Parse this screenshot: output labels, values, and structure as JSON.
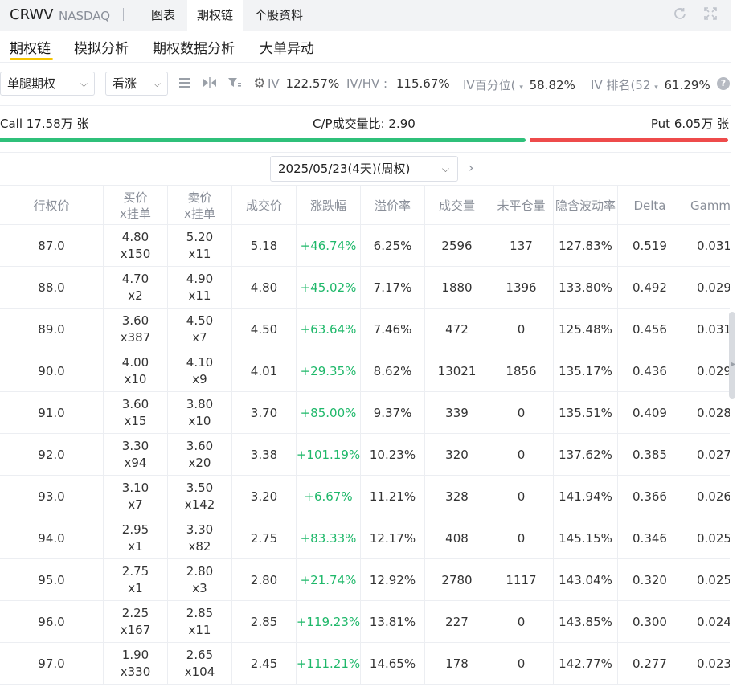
{
  "header": {
    "ticker": "CRWV",
    "exchange": "NASDAQ",
    "tabs": [
      "图表",
      "期权链",
      "个股资料"
    ],
    "active_tab": "期权链"
  },
  "subtabs": {
    "items": [
      "期权链",
      "模拟分析",
      "期权数据分析",
      "大单异动"
    ],
    "active": "期权链"
  },
  "toolbar": {
    "strategy_select": "单腿期权",
    "direction_select": "看涨",
    "iv_label": "IV",
    "iv_value": "122.57%",
    "ivhv_label": "IV/HV :",
    "ivhv_value": "115.67%",
    "ivpct_label": "IV百分位(",
    "ivpct_value": "58.82%",
    "ivrank_label": "IV 排名(52",
    "ivrank_value": "61.29%"
  },
  "ratio": {
    "call": "Call 17.58万 张",
    "cp": "C/P成交量比: 2.90",
    "put": "Put 6.05万 张",
    "call_fraction": 0.744
  },
  "expiry": {
    "selected": "2025/05/23(4天)(周权)"
  },
  "table": {
    "headers": [
      {
        "l1": "行权价",
        "l2": ""
      },
      {
        "l1": "买价",
        "l2": "x挂单"
      },
      {
        "l1": "卖价",
        "l2": "x挂单"
      },
      {
        "l1": "成交价",
        "l2": ""
      },
      {
        "l1": "涨跌幅",
        "l2": ""
      },
      {
        "l1": "溢价率",
        "l2": ""
      },
      {
        "l1": "成交量",
        "l2": ""
      },
      {
        "l1": "未平仓量",
        "l2": ""
      },
      {
        "l1": "隐含波动率",
        "l2": ""
      },
      {
        "l1": "Delta",
        "l2": ""
      },
      {
        "l1": "Gamm",
        "l2": ""
      }
    ],
    "rows": [
      {
        "strike": "87.0",
        "bid": "4.80",
        "bid_size": "x150",
        "ask": "5.20",
        "ask_size": "x11",
        "last": "5.18",
        "change": "+46.74%",
        "premium": "6.25%",
        "volume": "2596",
        "oi": "137",
        "iv": "127.83%",
        "delta": "0.519",
        "gamma": "0.031"
      },
      {
        "strike": "88.0",
        "bid": "4.70",
        "bid_size": "x2",
        "ask": "4.90",
        "ask_size": "x11",
        "last": "4.80",
        "change": "+45.02%",
        "premium": "7.17%",
        "volume": "1880",
        "oi": "1396",
        "iv": "133.80%",
        "delta": "0.492",
        "gamma": "0.029"
      },
      {
        "strike": "89.0",
        "bid": "3.60",
        "bid_size": "x387",
        "ask": "4.50",
        "ask_size": "x7",
        "last": "4.50",
        "change": "+63.64%",
        "premium": "7.46%",
        "volume": "472",
        "oi": "0",
        "iv": "125.48%",
        "delta": "0.456",
        "gamma": "0.031"
      },
      {
        "strike": "90.0",
        "bid": "4.00",
        "bid_size": "x10",
        "ask": "4.10",
        "ask_size": "x9",
        "last": "4.01",
        "change": "+29.35%",
        "premium": "8.62%",
        "volume": "13021",
        "oi": "1856",
        "iv": "135.17%",
        "delta": "0.436",
        "gamma": "0.029"
      },
      {
        "strike": "91.0",
        "bid": "3.60",
        "bid_size": "x15",
        "ask": "3.80",
        "ask_size": "x10",
        "last": "3.70",
        "change": "+85.00%",
        "premium": "9.37%",
        "volume": "339",
        "oi": "0",
        "iv": "135.51%",
        "delta": "0.409",
        "gamma": "0.028"
      },
      {
        "strike": "92.0",
        "bid": "3.30",
        "bid_size": "x94",
        "ask": "3.60",
        "ask_size": "x20",
        "last": "3.38",
        "change": "+101.19%",
        "premium": "10.23%",
        "volume": "320",
        "oi": "0",
        "iv": "137.62%",
        "delta": "0.385",
        "gamma": "0.027"
      },
      {
        "strike": "93.0",
        "bid": "3.10",
        "bid_size": "x7",
        "ask": "3.50",
        "ask_size": "x142",
        "last": "3.20",
        "change": "+6.67%",
        "premium": "11.21%",
        "volume": "328",
        "oi": "0",
        "iv": "141.94%",
        "delta": "0.366",
        "gamma": "0.026"
      },
      {
        "strike": "94.0",
        "bid": "2.95",
        "bid_size": "x1",
        "ask": "3.30",
        "ask_size": "x82",
        "last": "2.75",
        "change": "+83.33%",
        "premium": "12.17%",
        "volume": "408",
        "oi": "0",
        "iv": "145.15%",
        "delta": "0.346",
        "gamma": "0.025"
      },
      {
        "strike": "95.0",
        "bid": "2.75",
        "bid_size": "x1",
        "ask": "2.80",
        "ask_size": "x3",
        "last": "2.80",
        "change": "+21.74%",
        "premium": "12.92%",
        "volume": "2780",
        "oi": "1117",
        "iv": "143.04%",
        "delta": "0.320",
        "gamma": "0.025"
      },
      {
        "strike": "96.0",
        "bid": "2.25",
        "bid_size": "x167",
        "ask": "2.85",
        "ask_size": "x11",
        "last": "2.85",
        "change": "+119.23%",
        "premium": "13.81%",
        "volume": "227",
        "oi": "0",
        "iv": "143.85%",
        "delta": "0.300",
        "gamma": "0.024"
      },
      {
        "strike": "97.0",
        "bid": "1.90",
        "bid_size": "x330",
        "ask": "2.65",
        "ask_size": "x104",
        "last": "2.45",
        "change": "+111.21%",
        "premium": "14.65%",
        "volume": "178",
        "oi": "0",
        "iv": "142.77%",
        "delta": "0.277",
        "gamma": "0.023"
      }
    ]
  },
  "colors": {
    "call_bar": "#2fc07a",
    "put_bar": "#ee4b4b",
    "positive_change": "#1fb86a",
    "active_underline": "#f5c400"
  },
  "icons": [
    "refresh-icon",
    "fullscreen-icon",
    "list-view-icon",
    "split-view-icon",
    "filter-icon",
    "settings-gear-icon",
    "help-icon",
    "chevron-down-icon",
    "chevron-right-icon"
  ]
}
